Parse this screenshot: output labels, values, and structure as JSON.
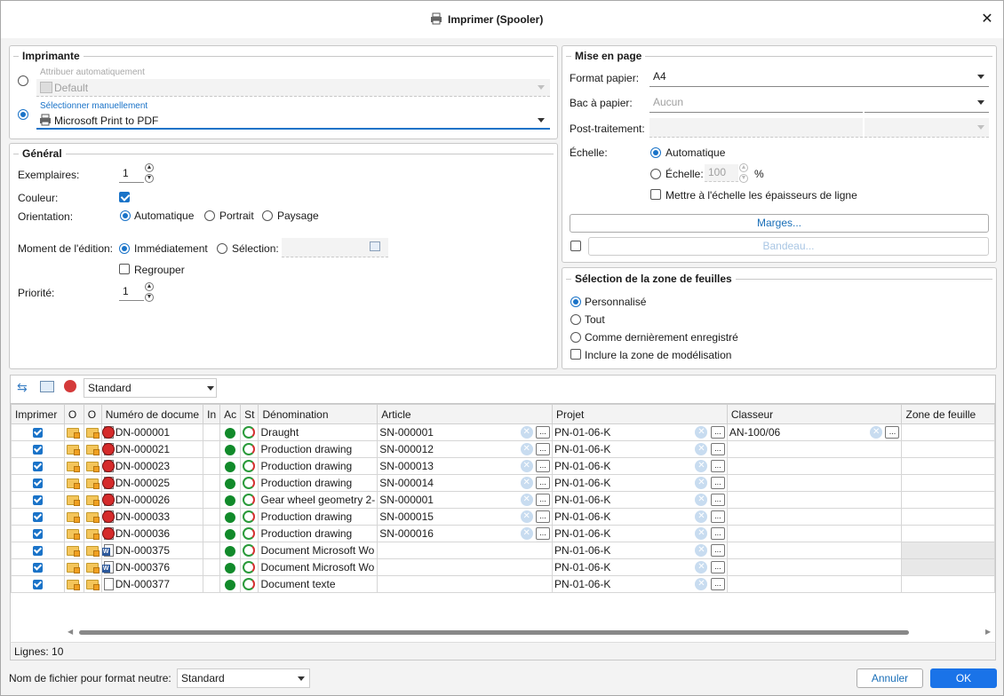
{
  "window": {
    "title": "Imprimer (Spooler)",
    "close": "✕"
  },
  "printer": {
    "section": "Imprimante",
    "auto_label": "Attribuer automatiquement",
    "auto_value": "Default",
    "manual_label": "Sélectionner manuellement",
    "manual_value": "Microsoft Print to PDF"
  },
  "general": {
    "section": "Général",
    "copies_label": "Exemplaires:",
    "copies_value": "1",
    "color_label": "Couleur:",
    "orientation_label": "Orientation:",
    "orientation_options": [
      "Automatique",
      "Portrait",
      "Paysage"
    ],
    "moment_label": "Moment de l'édition:",
    "moment_options": [
      "Immédiatement",
      "Sélection:"
    ],
    "group_label": "Regrouper",
    "priority_label": "Priorité:",
    "priority_value": "1"
  },
  "layout": {
    "section": "Mise en page",
    "paper_label": "Format papier:",
    "paper_value": "A4",
    "tray_label": "Bac à papier:",
    "tray_value": "Aucun",
    "post_label": "Post-traitement:",
    "scale_label": "Échelle:",
    "scale_auto": "Automatique",
    "scale_manual": "Échelle:",
    "scale_value": "100",
    "scale_unit": "%",
    "line_scale": "Mettre à l'échelle les épaisseurs de ligne",
    "margins_button": "Marges...",
    "banner_button": "Bandeau..."
  },
  "sheets": {
    "section": "Sélection de la zone de feuilles",
    "options": [
      "Personnalisé",
      "Tout",
      "Comme dernièrement enregistré"
    ],
    "include_label": "Inclure la zone de modélisation"
  },
  "toolbar": {
    "profile": "Standard"
  },
  "table": {
    "columns": [
      "Imprimer",
      "O",
      "O",
      "Numéro de docume",
      "In",
      "Ac",
      "St",
      "Dénomination",
      "Article",
      "Projet",
      "Classeur",
      "Zone de feuille"
    ],
    "rows": [
      {
        "num": "DN-000001",
        "icon": "red",
        "name": "Draught",
        "article": "SN-000001",
        "project": "PN-01-06-K",
        "classeur": "AN-100/06"
      },
      {
        "num": "DN-000021",
        "icon": "red",
        "name": "Production drawing",
        "article": "SN-000012",
        "project": "PN-01-06-K",
        "classeur": ""
      },
      {
        "num": "DN-000023",
        "icon": "red",
        "name": "Production drawing",
        "article": "SN-000013",
        "project": "PN-01-06-K",
        "classeur": ""
      },
      {
        "num": "DN-000025",
        "icon": "red",
        "name": "Production drawing",
        "article": "SN-000014",
        "project": "PN-01-06-K",
        "classeur": ""
      },
      {
        "num": "DN-000026",
        "icon": "red",
        "name": "Gear wheel geometry 2-",
        "article": "SN-000001",
        "project": "PN-01-06-K",
        "classeur": ""
      },
      {
        "num": "DN-000033",
        "icon": "red",
        "name": "Production drawing",
        "article": "SN-000015",
        "project": "PN-01-06-K",
        "classeur": ""
      },
      {
        "num": "DN-000036",
        "icon": "red",
        "name": "Production drawing",
        "article": "SN-000016",
        "project": "PN-01-06-K",
        "classeur": ""
      },
      {
        "num": "DN-000375",
        "icon": "word",
        "name": "Document Microsoft Wo",
        "article": "",
        "project": "PN-01-06-K",
        "classeur": ""
      },
      {
        "num": "DN-000376",
        "icon": "word",
        "name": "Document Microsoft Wo",
        "article": "",
        "project": "PN-01-06-K",
        "classeur": ""
      },
      {
        "num": "DN-000377",
        "icon": "text",
        "name": "Document texte",
        "article": "",
        "project": "PN-01-06-K",
        "classeur": ""
      }
    ],
    "lines_label": "Lignes: 10"
  },
  "footer": {
    "neutral_label": "Nom de fichier pour format neutre:",
    "neutral_value": "Standard",
    "cancel": "Annuler",
    "ok": "OK"
  }
}
